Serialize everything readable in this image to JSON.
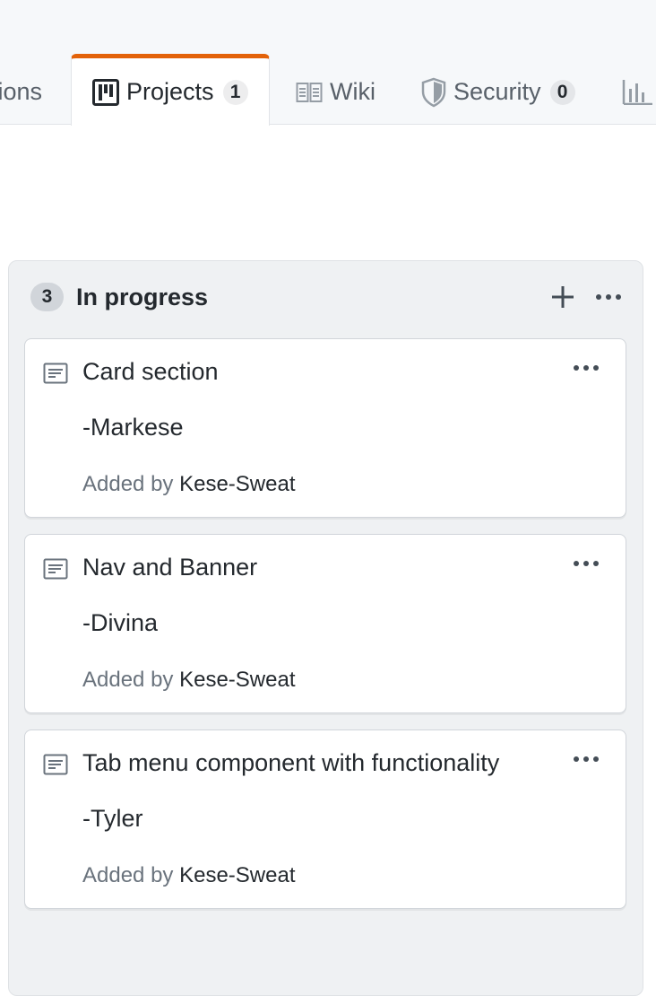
{
  "tabs": [
    {
      "label": "tions",
      "count": null,
      "icon": "actions-icon"
    },
    {
      "label": "Projects",
      "count": "1",
      "icon": "project-board-icon",
      "selected": true
    },
    {
      "label": "Wiki",
      "count": null,
      "icon": "book-icon"
    },
    {
      "label": "Security",
      "count": "0",
      "icon": "shield-icon"
    },
    {
      "label": "",
      "count": null,
      "icon": "graph-icon"
    }
  ],
  "column": {
    "count": "3",
    "title": "In progress",
    "add_icon": "plus-icon",
    "menu_icon": "kebab-horizontal-icon"
  },
  "cards": [
    {
      "title": "Card section",
      "note": "-Markese",
      "added_prefix": "Added by",
      "author": "Kese-Sweat"
    },
    {
      "title": "Nav and Banner",
      "note": "-Divina",
      "added_prefix": "Added by",
      "author": "Kese-Sweat"
    },
    {
      "title": "Tab menu component with functionality",
      "note": "-Tyler",
      "added_prefix": "Added by",
      "author": "Kese-Sweat"
    }
  ],
  "colors": {
    "accent": "#e36209",
    "column_bg": "#eff1f3",
    "muted_text": "#6a737d"
  }
}
